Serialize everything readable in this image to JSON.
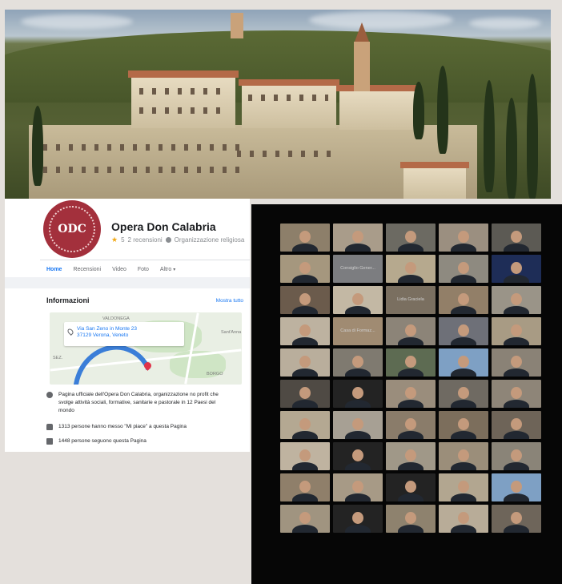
{
  "photo": {
    "subject": "aerial-complex-photo"
  },
  "facebook": {
    "avatar_text": "ODC",
    "page_name": "Opera Don Calabria",
    "rating": "5",
    "reviews": "2 recensioni",
    "category": "Organizzazione religiosa",
    "tabs": [
      "Home",
      "Recensioni",
      "Video",
      "Foto",
      "Altro"
    ],
    "tab_caret": "▾",
    "info": {
      "title": "Informazioni",
      "see_all": "Mostra tutto",
      "map": {
        "labels": [
          "VALDONEGA",
          "Sant'Anna",
          "SEZ.",
          "BORGO"
        ],
        "address_line1": "Via San Zeno in Monte 23",
        "address_line2": "37129 Verona, Veneto"
      },
      "rows": [
        {
          "icon": "info-icon",
          "text": "Pagina ufficiale dell'Opera Don Calabria, organizzazione no profit che svolge attività sociali, formative, sanitarie e pastorale in 12 Paesi del mondo"
        },
        {
          "icon": "like-icon",
          "text": "1313 persone hanno messo \"Mi piace\" a questa Pagina"
        },
        {
          "icon": "follow-icon",
          "text": "1448 persone seguono questa Pagina"
        }
      ]
    }
  },
  "zoom": {
    "tile_backgrounds": [
      "#8d7f6a",
      "#a99c8a",
      "#6c6a62",
      "#9b8f80",
      "#5c5a54",
      "#a5977e",
      "#7c7d80",
      "#b6a98e",
      "#8e8a80",
      "#1e2d57",
      "#6b5b4c",
      "#c3b8a4",
      "#7a6f60",
      "#927f68",
      "#9a9488",
      "#bdb2a0",
      "#a08b72",
      "#8c8478",
      "#6e7078",
      "#a89b84",
      "#b9ae9c",
      "#7f7a70",
      "#5d6b52",
      "#7ea0c4",
      "#8a8276",
      "#4f4a44",
      "#232323",
      "#9a8d7c",
      "#6f6a62",
      "#8e8578",
      "#b4a892",
      "#a7a094",
      "#8a7c6a",
      "#7c6e5c",
      "#6e6458",
      "#bfb3a0",
      "#232323",
      "#a09888",
      "#9b8e7a",
      "#8a8478",
      "#8f7f6a",
      "#a79a86",
      "#232323",
      "#b2a690",
      "#7ea0c4",
      "#a09480",
      "#232323",
      "#8e826e",
      "#b8ac98",
      "#6e655a"
    ],
    "tile_labels": {
      "6": "Consiglio Gener...",
      "12": "Lidia Graciela",
      "16": "Casa di Formaz..."
    },
    "participants_count": "50"
  }
}
